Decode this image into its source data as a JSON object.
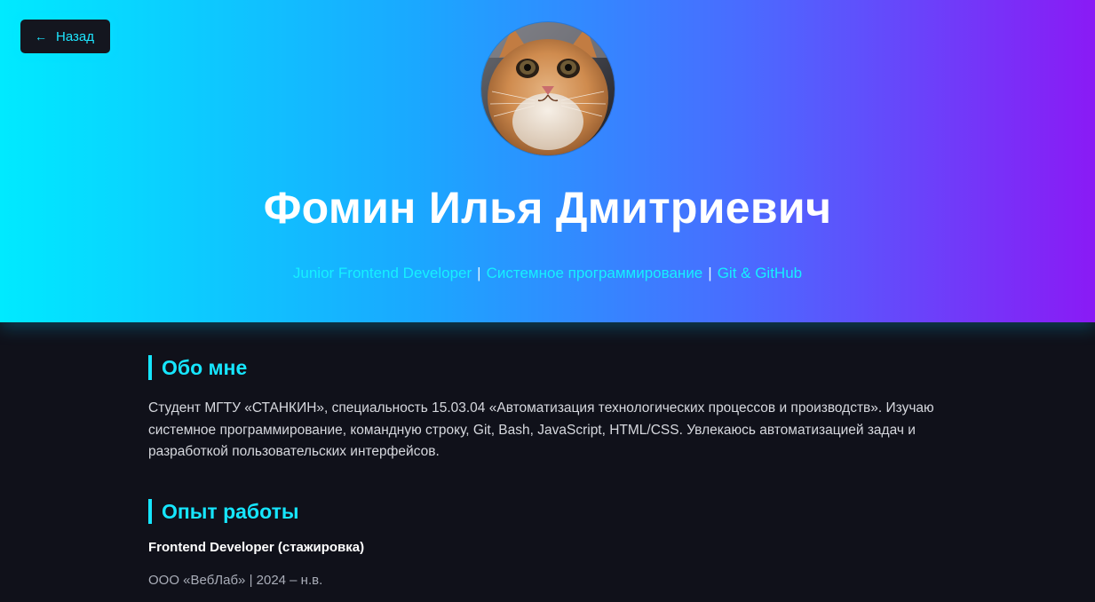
{
  "header": {
    "back_label": "Назад",
    "name": "Фомин Илья Дмитриевич",
    "subtitle_parts": [
      "Junior Frontend Developer",
      "Системное программирование",
      "Git & GitHub"
    ],
    "subtitle_separator": "|"
  },
  "about": {
    "title": "Обо мне",
    "text": "Студент МГТУ «СТАНКИН», специальность 15.03.04 «Автоматизация технологических процессов и производств». Изучаю системное программирование, командную строку, Git, Bash, JavaScript, HTML/CSS. Увлекаюсь автоматизацией задач и разработкой пользовательских интерфейсов."
  },
  "experience": {
    "title": "Опыт работы",
    "role": "Frontend Developer (стажировка)",
    "meta": "ООО «ВебЛаб» | 2024 – н.в."
  },
  "colors": {
    "accent": "#16e6ff",
    "gradient_start": "#00eaff",
    "gradient_end": "#8a1af5",
    "background": "#10111a"
  },
  "icons": {
    "back": "arrow-left-icon"
  }
}
